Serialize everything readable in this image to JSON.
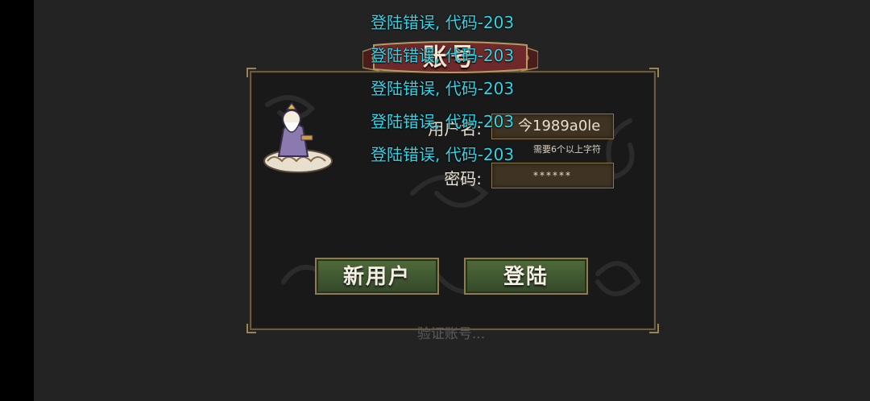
{
  "title": "账号",
  "form": {
    "username_label": "用户名:",
    "username_value": "今1989a0le",
    "username_hint": "需要6个以上字符",
    "password_label": "密码:",
    "password_value": "******"
  },
  "buttons": {
    "new_user": "新用户",
    "login": "登陆"
  },
  "status": "验证账号...",
  "errors": [
    "登陆错误, 代码-203",
    "登陆错误, 代码-203",
    "登陆错误, 代码-203",
    "登陆错误, 代码-203",
    "登陆错误, 代码-203"
  ],
  "colors": {
    "error_text": "#2fd5e8",
    "button_green": "#3f5a32",
    "panel_border": "#6b5a3c"
  }
}
